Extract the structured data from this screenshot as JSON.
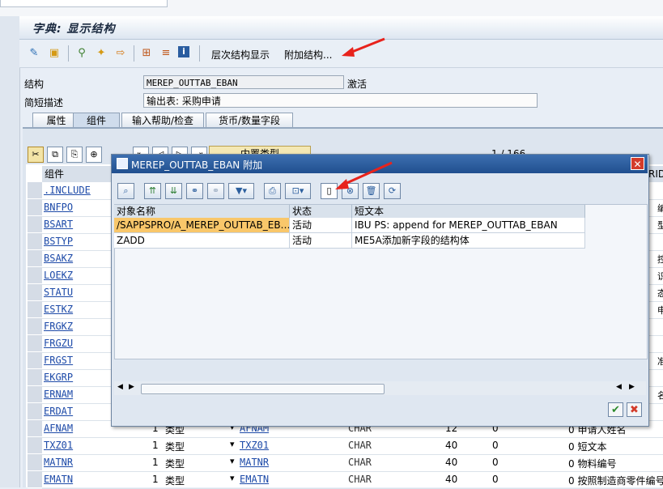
{
  "window": {
    "title": "字典: 显示结构"
  },
  "toolbar": {
    "hierarchy_label": "层次结构显示",
    "append_label": "附加结构..."
  },
  "form": {
    "structure_label": "结构",
    "structure_value": "MEREP_OUTTAB_EBAN",
    "status": "激活",
    "desc_label": "简短描述",
    "desc_value": "输出表: 采购申请"
  },
  "tabs": [
    "属性",
    "组件",
    "输入帮助/检查",
    "货币/数量字段"
  ],
  "background": {
    "grid_toolbar_label": "内置类型",
    "page_counter": "1 / 166",
    "column_component": "组件",
    "column_right": "RID",
    "rows": [
      {
        "component": ".INCLUDE",
        "right": ""
      },
      {
        "component": "BNFPO",
        "right": "编号"
      },
      {
        "component": "BSART",
        "right": "型"
      },
      {
        "component": "BSTYP",
        "right": ""
      },
      {
        "component": "BSAKZ",
        "right": "控制"
      },
      {
        "component": "LOEKZ",
        "right": "识"
      },
      {
        "component": "STATU",
        "right": "态"
      },
      {
        "component": "ESTKZ",
        "right": "申请"
      },
      {
        "component": "FRGKZ",
        "right": ""
      },
      {
        "component": "FRGZU",
        "right": ""
      },
      {
        "component": "FRGST",
        "right": "准策"
      },
      {
        "component": "EKGRP",
        "right": ""
      },
      {
        "component": "ERNAM",
        "right": "名称"
      },
      {
        "component": "ERDAT",
        "right": ""
      }
    ],
    "full_rows": [
      {
        "component": "AFNAM",
        "num": "1",
        "type": "类型",
        "elem": "AFNAM",
        "dtype": "CHAR",
        "len": "12",
        "dec": "0",
        "desc": "0 申请人姓名"
      },
      {
        "component": "TXZ01",
        "num": "1",
        "type": "类型",
        "elem": "TXZ01",
        "dtype": "CHAR",
        "len": "40",
        "dec": "0",
        "desc": "0 短文本"
      },
      {
        "component": "MATNR",
        "num": "1",
        "type": "类型",
        "elem": "MATNR",
        "dtype": "CHAR",
        "len": "40",
        "dec": "0",
        "desc": "0 物料编号"
      },
      {
        "component": "EMATN",
        "num": "1",
        "type": "类型",
        "elem": "EMATN",
        "dtype": "CHAR",
        "len": "40",
        "dec": "0",
        "desc": "0 按照制造商零件编号"
      }
    ]
  },
  "dialog": {
    "title": "MEREP_OUTTAB_EBAN 附加",
    "close": "✕",
    "columns": [
      "对象名称",
      "状态",
      "短文本"
    ],
    "rows": [
      {
        "name": "/SAPPSPRO/A_MEREP_OUTTAB_EB…",
        "status": "活动",
        "text": "IBU PS: append for MEREP_OUTTAB_EBAN"
      },
      {
        "name": "ZADD",
        "status": "活动",
        "text": "ME5A添加新字段的结构体"
      }
    ],
    "ok": "✔",
    "cancel": "✖"
  },
  "colors": {
    "accent": "#2a5da0",
    "highlight_row": "#f9c76a",
    "arrow": "#e8231c"
  }
}
